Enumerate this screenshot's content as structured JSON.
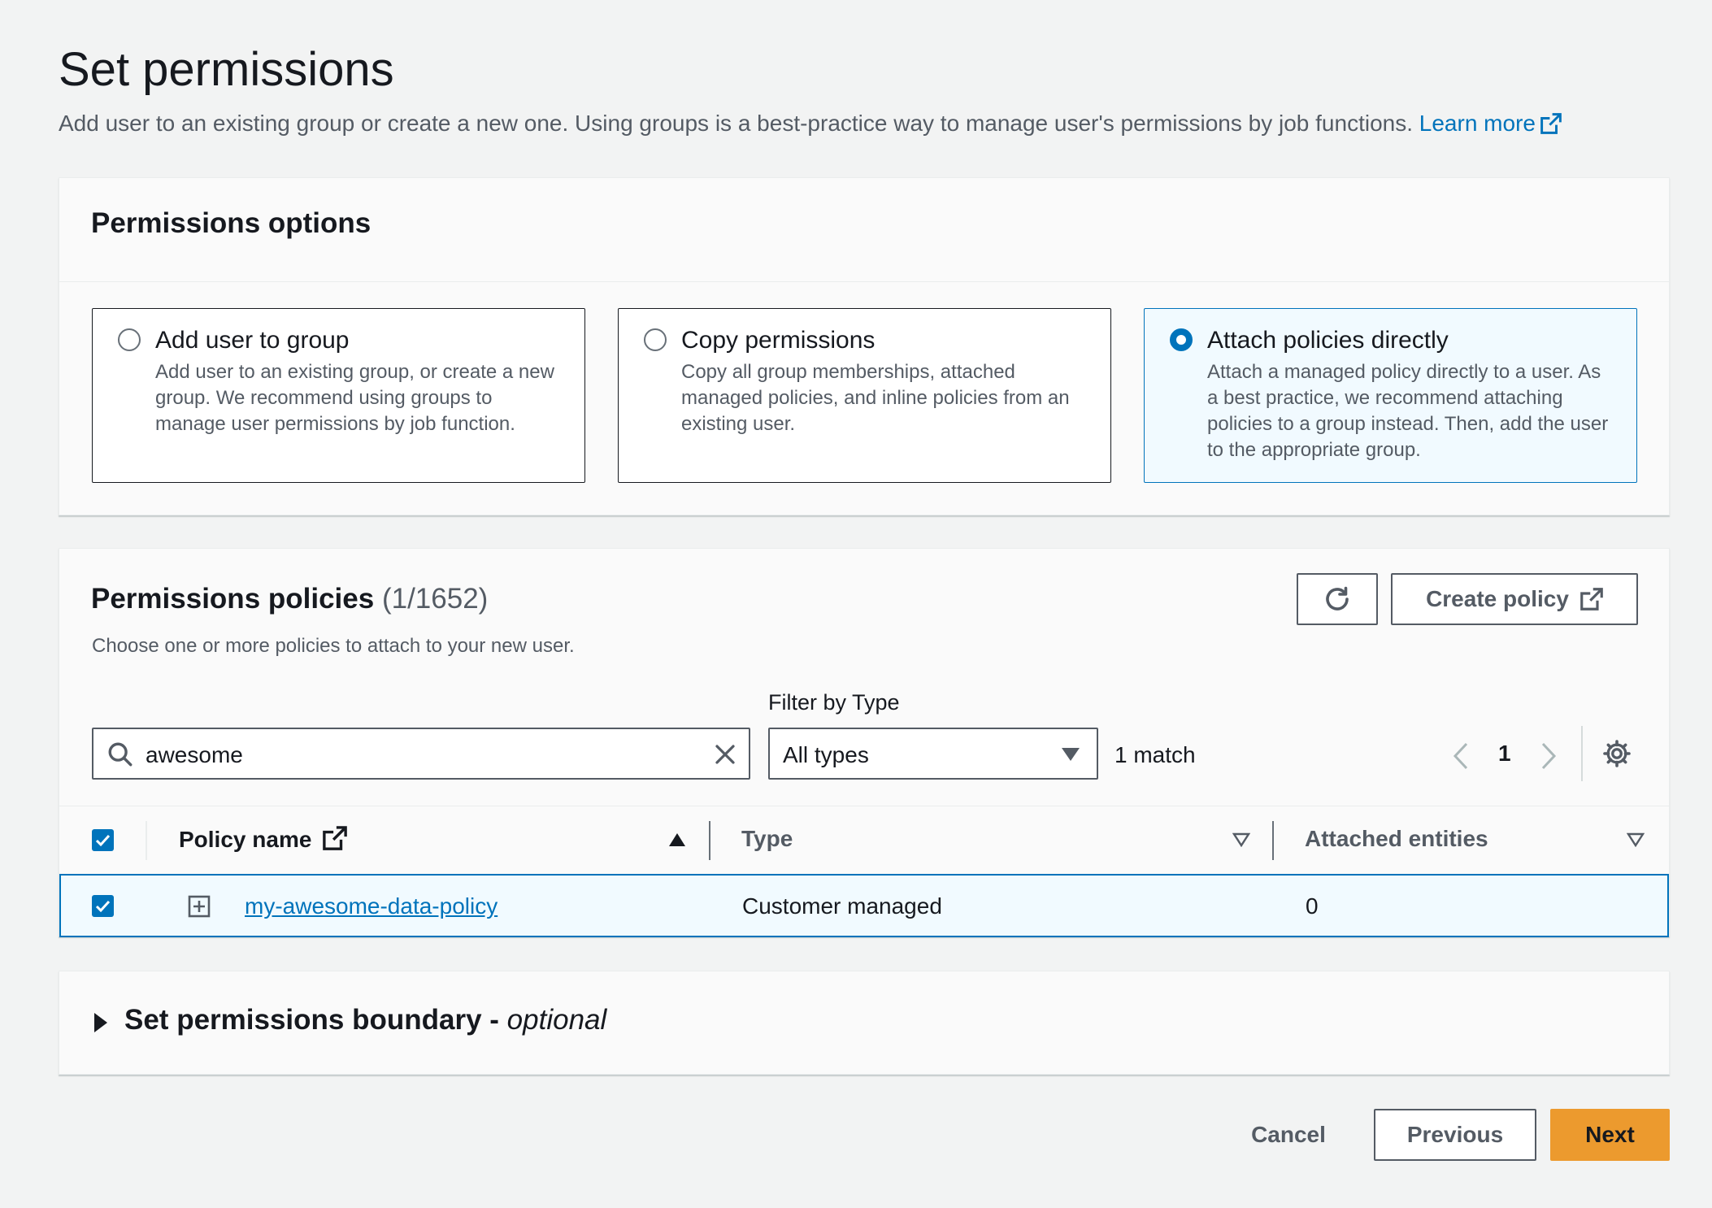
{
  "page": {
    "title": "Set permissions",
    "description": "Add user to an existing group or create a new one. Using groups is a best-practice way to manage user's permissions by job functions.",
    "learn_more": "Learn more"
  },
  "permissions_options": {
    "title": "Permissions options",
    "options": [
      {
        "title": "Add user to group",
        "description": "Add user to an existing group, or create a new group. We recommend using groups to manage user permissions by job function.",
        "selected": false
      },
      {
        "title": "Copy permissions",
        "description": "Copy all group memberships, attached managed policies, and inline policies from an existing user.",
        "selected": false
      },
      {
        "title": "Attach policies directly",
        "description": "Attach a managed policy directly to a user. As a best practice, we recommend attaching policies to a group instead. Then, add the user to the appropriate group.",
        "selected": true
      }
    ]
  },
  "policies": {
    "title": "Permissions policies",
    "count": "(1/1652)",
    "description": "Choose one or more policies to attach to your new user.",
    "create_policy_label": "Create policy",
    "filter_label": "Filter by Type",
    "search_value": "awesome",
    "filter_value": "All types",
    "match_text": "1 match",
    "page_number": "1",
    "columns": {
      "policy_name": "Policy name",
      "type": "Type",
      "attached_entities": "Attached entities"
    },
    "rows": [
      {
        "policy_name": "my-awesome-data-policy",
        "type": "Customer managed",
        "attached_entities": "0",
        "checked": true
      }
    ]
  },
  "boundary": {
    "title": "Set permissions boundary -",
    "optional": "optional"
  },
  "footer": {
    "cancel": "Cancel",
    "previous": "Previous",
    "next": "Next"
  },
  "colors": {
    "accent": "#0073bb",
    "primary_button": "#ec9a2e",
    "background": "#f2f3f3"
  }
}
